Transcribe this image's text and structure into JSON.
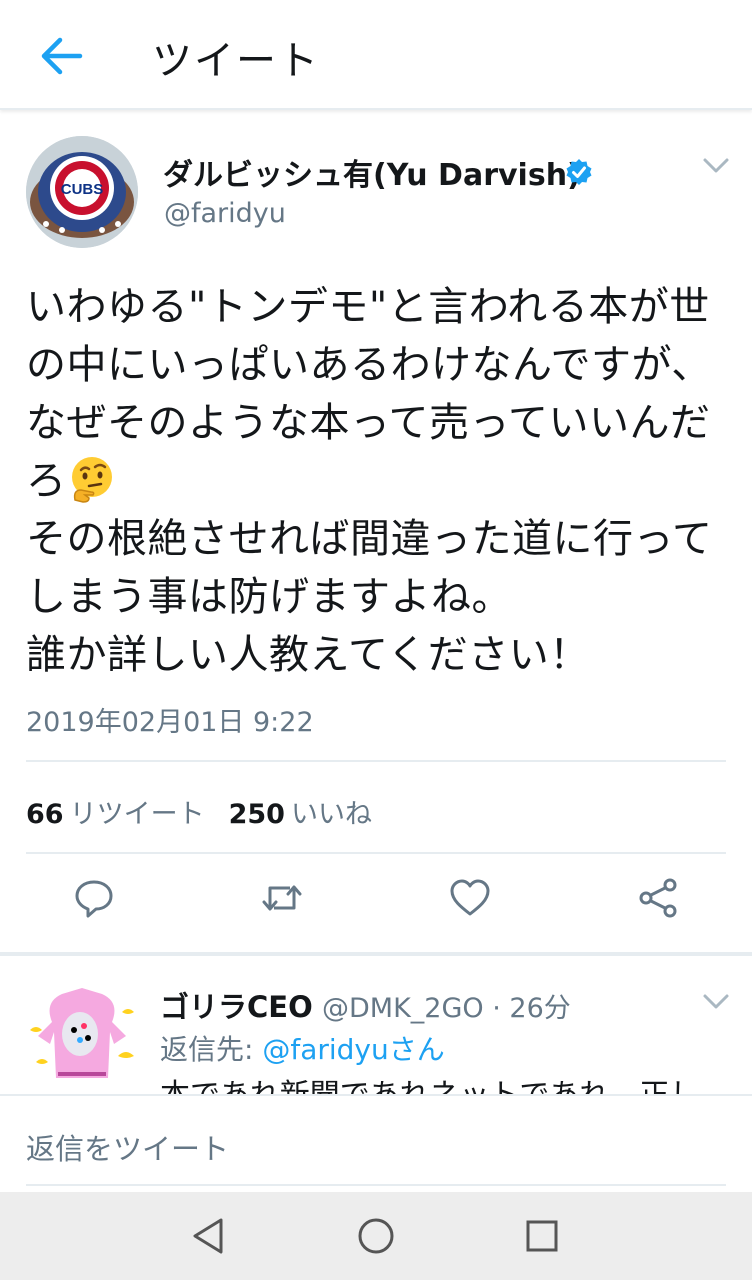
{
  "topbar": {
    "title": "ツイート"
  },
  "tweet": {
    "display_name": "ダルビッシュ有(Yu Darvish)",
    "handle": "@faridyu",
    "avatar_text": "CUBS",
    "body_before_emoji": "いわゆる\"トンデモ\"と言われる本が世の中にいっぱいあるわけなんですが、なぜそのような本って売っていいんだろ",
    "body_after_emoji": "その根絶させれば間違った道に行ってしまう事は防げますよね。\n誰か詳しい人教えてください！",
    "timestamp": "2019年02月01日 9:22",
    "retweet_count": "66",
    "retweet_label": "リツイート",
    "like_count": "250",
    "like_label": "いいね"
  },
  "reply": {
    "display_name": "ゴリラCEO",
    "meta": "@DMK_2GO · 26分",
    "reply_to_prefix": "返信先: ",
    "reply_to_mention": "@faridyuさん",
    "text": "本であれ新聞であれネットであれ、正し"
  },
  "composer": {
    "placeholder": "返信をツイート"
  },
  "colors": {
    "accent": "#1da1f2",
    "secondary_text": "#657786",
    "divider": "#e6ecf0"
  },
  "icons": [
    "back-arrow-icon",
    "verified-badge-icon",
    "chevron-down-icon",
    "reply-icon",
    "retweet-icon",
    "like-icon",
    "share-icon",
    "nav-back-icon",
    "nav-home-icon",
    "nav-recents-icon",
    "thinking-face-emoji"
  ]
}
